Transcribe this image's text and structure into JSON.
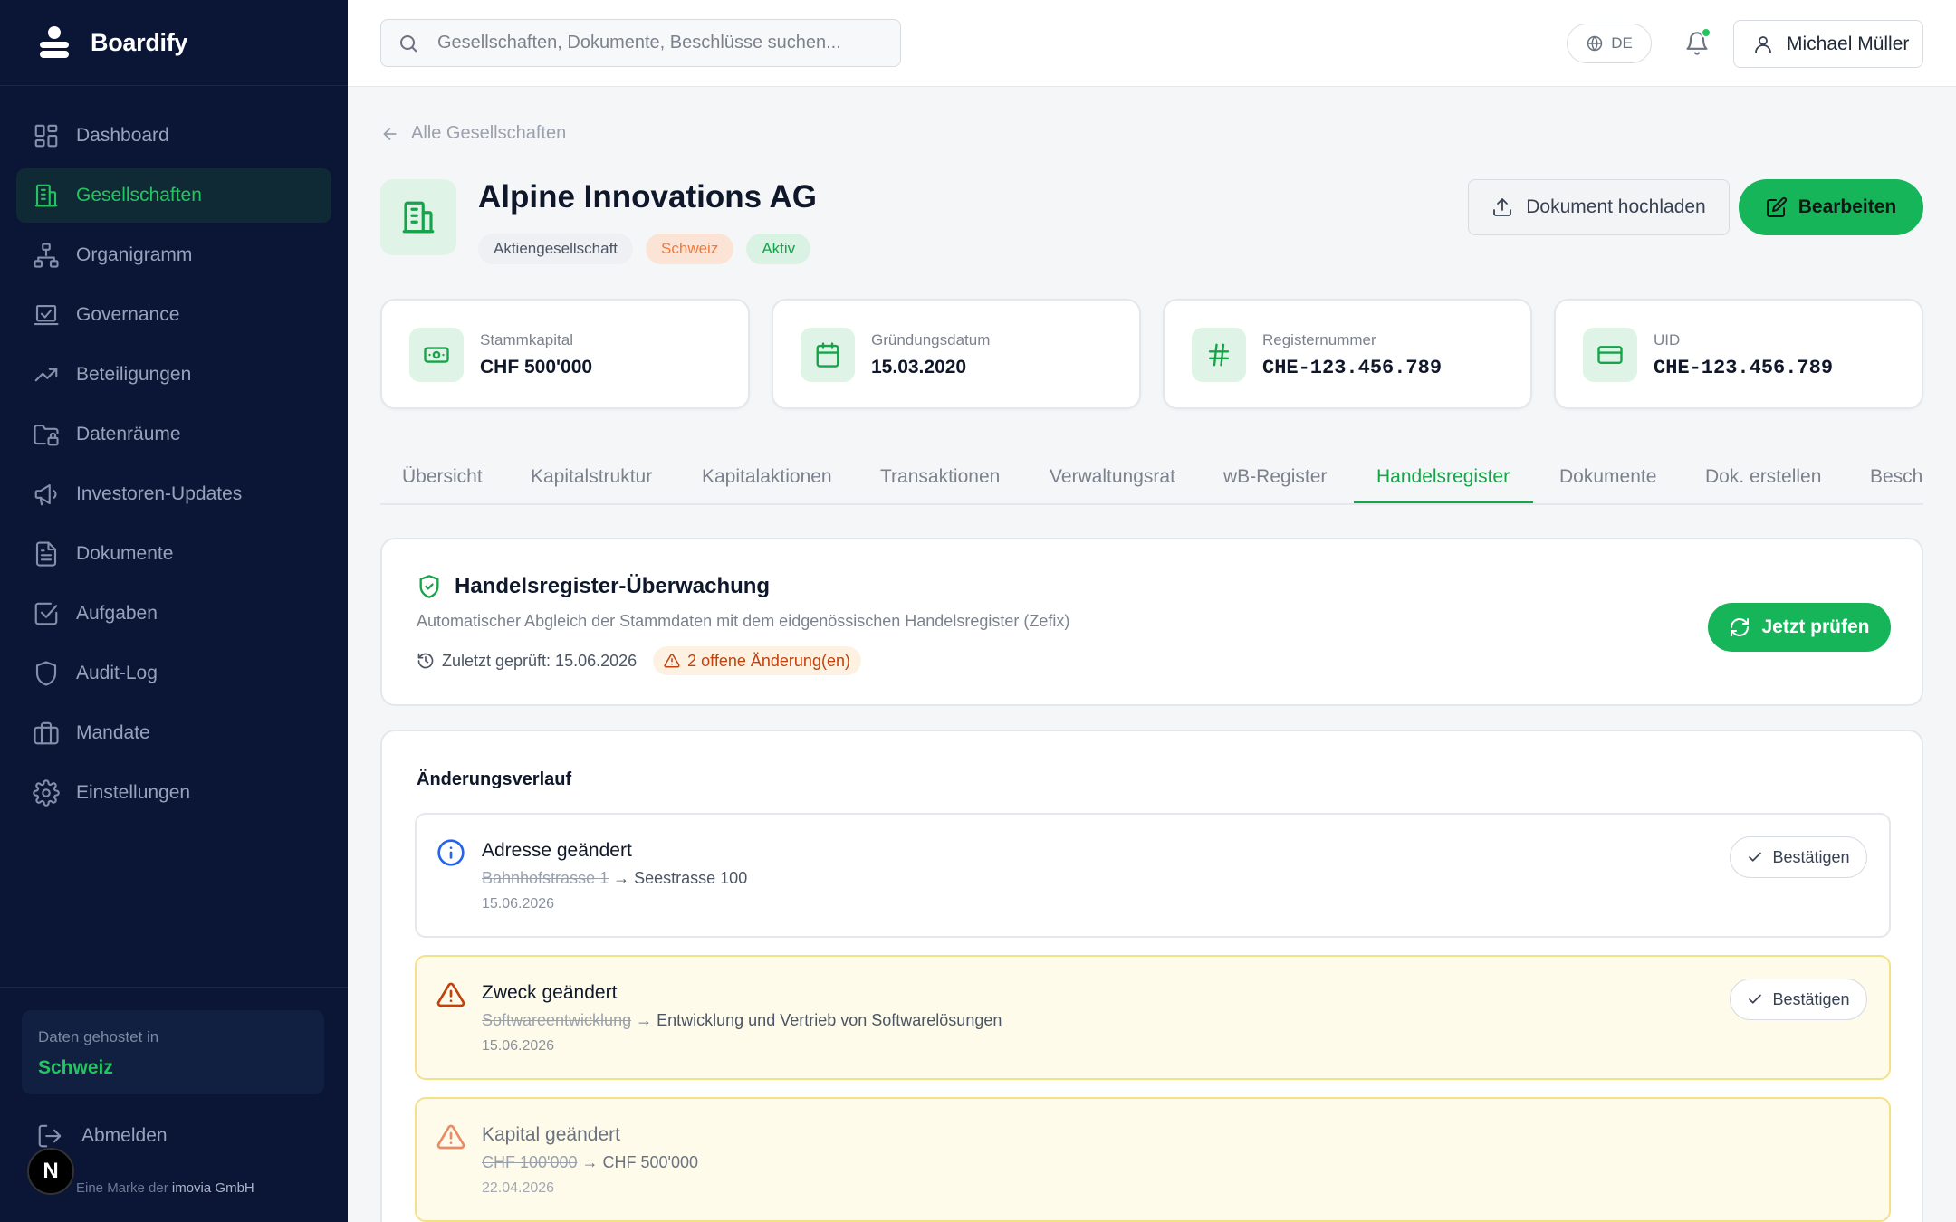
{
  "brand": {
    "name": "Boardify"
  },
  "sidebar": {
    "items": [
      {
        "label": "Dashboard",
        "icon": "dashboard-icon",
        "active": false
      },
      {
        "label": "Gesellschaften",
        "icon": "building-icon",
        "active": true
      },
      {
        "label": "Organigramm",
        "icon": "org-chart-icon",
        "active": false
      },
      {
        "label": "Governance",
        "icon": "governance-icon",
        "active": false
      },
      {
        "label": "Beteiligungen",
        "icon": "trending-up-icon",
        "active": false
      },
      {
        "label": "Datenräume",
        "icon": "folder-lock-icon",
        "active": false
      },
      {
        "label": "Investoren-Updates",
        "icon": "megaphone-icon",
        "active": false
      },
      {
        "label": "Dokumente",
        "icon": "document-icon",
        "active": false
      },
      {
        "label": "Aufgaben",
        "icon": "checkbox-icon",
        "active": false
      },
      {
        "label": "Audit-Log",
        "icon": "shield-icon",
        "active": false
      },
      {
        "label": "Mandate",
        "icon": "briefcase-icon",
        "active": false
      },
      {
        "label": "Einstellungen",
        "icon": "gear-icon",
        "active": false
      }
    ],
    "hosted_label": "Daten gehostet in",
    "hosted_value": "Schweiz",
    "logout_label": "Abmelden",
    "footer_prefix": "Eine Marke der",
    "footer_company": "imovia GmbH",
    "badge_letter": "N"
  },
  "topbar": {
    "search_placeholder": "Gesellschaften, Dokumente, Beschlüsse suchen...",
    "language": "DE",
    "user_name": "Michael Müller"
  },
  "company": {
    "back_label": "Alle Gesellschaften",
    "name": "Alpine Innovations AG",
    "tags": [
      "Aktiengesellschaft",
      "Schweiz",
      "Aktiv"
    ],
    "upload_label": "Dokument hochladen",
    "edit_label": "Bearbeiten"
  },
  "cards": [
    {
      "label": "Stammkapital",
      "value": "CHF 500'000",
      "icon": "banknote-icon"
    },
    {
      "label": "Gründungsdatum",
      "value": "15.03.2020",
      "icon": "calendar-icon"
    },
    {
      "label": "Registernummer",
      "value": "CHE-123.456.789",
      "icon": "hash-icon"
    },
    {
      "label": "UID",
      "value": "CHE-123.456.789",
      "icon": "credit-card-icon"
    }
  ],
  "tabs": [
    {
      "label": "Übersicht"
    },
    {
      "label": "Kapitalstruktur"
    },
    {
      "label": "Kapitalaktionen"
    },
    {
      "label": "Transaktionen"
    },
    {
      "label": "Verwaltungsrat"
    },
    {
      "label": "wB-Register"
    },
    {
      "label": "Handelsregister",
      "active": true
    },
    {
      "label": "Dokumente"
    },
    {
      "label": "Dok. erstellen"
    },
    {
      "label": "Besch"
    }
  ],
  "monitor": {
    "title": "Handelsregister-Überwachung",
    "subtitle": "Automatischer Abgleich der Stammdaten mit dem eidgenössischen Handelsregister (Zefix)",
    "last_checked": "Zuletzt geprüft: 15.06.2026",
    "open_changes": "2 offene Änderung(en)",
    "check_label": "Jetzt prüfen"
  },
  "history": {
    "title": "Änderungsverlauf",
    "confirm_label": "Bestätigen",
    "changes": [
      {
        "title": "Adresse geändert",
        "old": "Bahnhofstrasse 1",
        "arrow": "→",
        "new": "Seestrasse 100",
        "date": "15.06.2026",
        "severity": "info"
      },
      {
        "title": "Zweck geändert",
        "old": "Softwareentwicklung",
        "arrow": "→",
        "new": "Entwicklung und Vertrieb von Softwarelösungen",
        "date": "15.06.2026",
        "severity": "warning"
      },
      {
        "title": "Kapital geändert",
        "old": "CHF 100'000",
        "arrow": "→",
        "new": "CHF 500'000",
        "date": "22.04.2026",
        "severity": "warning"
      }
    ]
  },
  "colors": {
    "sidebar_bg": "#0b1636",
    "accent": "#16b55a",
    "warning": "#c2410c",
    "info": "#2563eb"
  }
}
